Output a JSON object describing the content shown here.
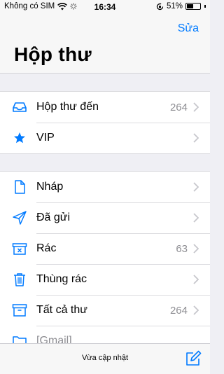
{
  "status": {
    "carrier": "Không có SIM",
    "time": "16:34",
    "battery": "51%",
    "battery_level": 0.51
  },
  "header": {
    "edit_label": "Sửa",
    "title": "Hộp thư"
  },
  "mailboxes_primary": [
    {
      "label": "Hộp thư đến",
      "count": "264",
      "icon": "inbox-icon"
    },
    {
      "label": "VIP",
      "count": "",
      "icon": "star-icon"
    }
  ],
  "mailboxes_folders": [
    {
      "label": "Nháp",
      "count": "",
      "icon": "draft-icon"
    },
    {
      "label": "Đã gửi",
      "count": "",
      "icon": "sent-icon"
    },
    {
      "label": "Rác",
      "count": "63",
      "icon": "junk-icon"
    },
    {
      "label": "Thùng rác",
      "count": "",
      "icon": "trash-icon"
    },
    {
      "label": "Tất cả thư",
      "count": "264",
      "icon": "archive-icon"
    },
    {
      "label": "[Gmail]",
      "count": "",
      "icon": "folder-icon"
    }
  ],
  "toolbar": {
    "status_text": "Vừa cập nhật",
    "compose_icon": "compose-icon"
  },
  "colors": {
    "accent": "#007aff",
    "background": "#efeff4",
    "secondary_text": "#8e8e93"
  }
}
